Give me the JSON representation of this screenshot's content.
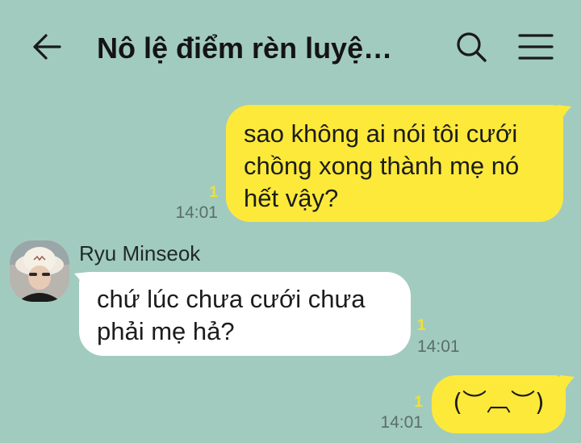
{
  "header": {
    "title": "Nô lệ điểm rèn luyệ…",
    "back_icon": "arrow-left-icon",
    "search_icon": "search-icon",
    "menu_icon": "hamburger-menu-icon"
  },
  "colors": {
    "background": "#a2cbbf",
    "outgoing_bubble": "#fde93a",
    "incoming_bubble": "#ffffff",
    "read_count": "#f3e12f"
  },
  "messages": [
    {
      "direction": "outgoing",
      "lines": [
        "sao không ai nói tôi cưới",
        "chồng xong thành mẹ nó",
        "hết vậy?"
      ],
      "read_count": "1",
      "time": "14:01"
    },
    {
      "direction": "incoming",
      "sender": "Ryu Minseok",
      "lines": [
        "chứ lúc chưa cưới chưa",
        "phải mẹ hả?"
      ],
      "read_count": "1",
      "time": "14:01"
    },
    {
      "direction": "outgoing",
      "lines": [
        "(︶︹︶)"
      ],
      "read_count": "1",
      "time": "14:01"
    }
  ]
}
